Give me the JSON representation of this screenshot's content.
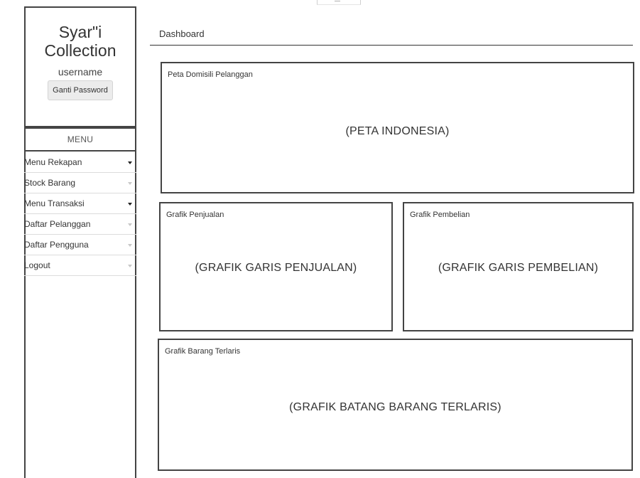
{
  "sidebar": {
    "brand_line1": "Syar\"i",
    "brand_line2": "Collection",
    "username": "username",
    "change_password_label": "Ganti Password",
    "menu_header": "MENU",
    "items": [
      {
        "label": "Menu Rekapan",
        "caret": "dark"
      },
      {
        "label": "Stock Barang",
        "caret": "light"
      },
      {
        "label": "Menu Transaksi",
        "caret": "dark"
      },
      {
        "label": "Daftar Pelanggan",
        "caret": "light"
      },
      {
        "label": "Daftar Pengguna",
        "caret": "light"
      },
      {
        "label": "Logout",
        "caret": "light"
      }
    ]
  },
  "main": {
    "title": "Dashboard",
    "panels": {
      "map": {
        "label": "Peta Domisili Pelanggan",
        "placeholder": "(PETA INDONESIA)"
      },
      "sales": {
        "label": "Grafik Penjualan",
        "placeholder": "(GRAFIK GARIS PENJUALAN)"
      },
      "purchase": {
        "label": "Grafik Pembelian",
        "placeholder": "(GRAFIK GARIS PEMBELIAN)"
      },
      "bestseller": {
        "label": "Grafik Barang Terlaris",
        "placeholder": "(GRAFIK BATANG BARANG TERLARIS)"
      }
    }
  }
}
